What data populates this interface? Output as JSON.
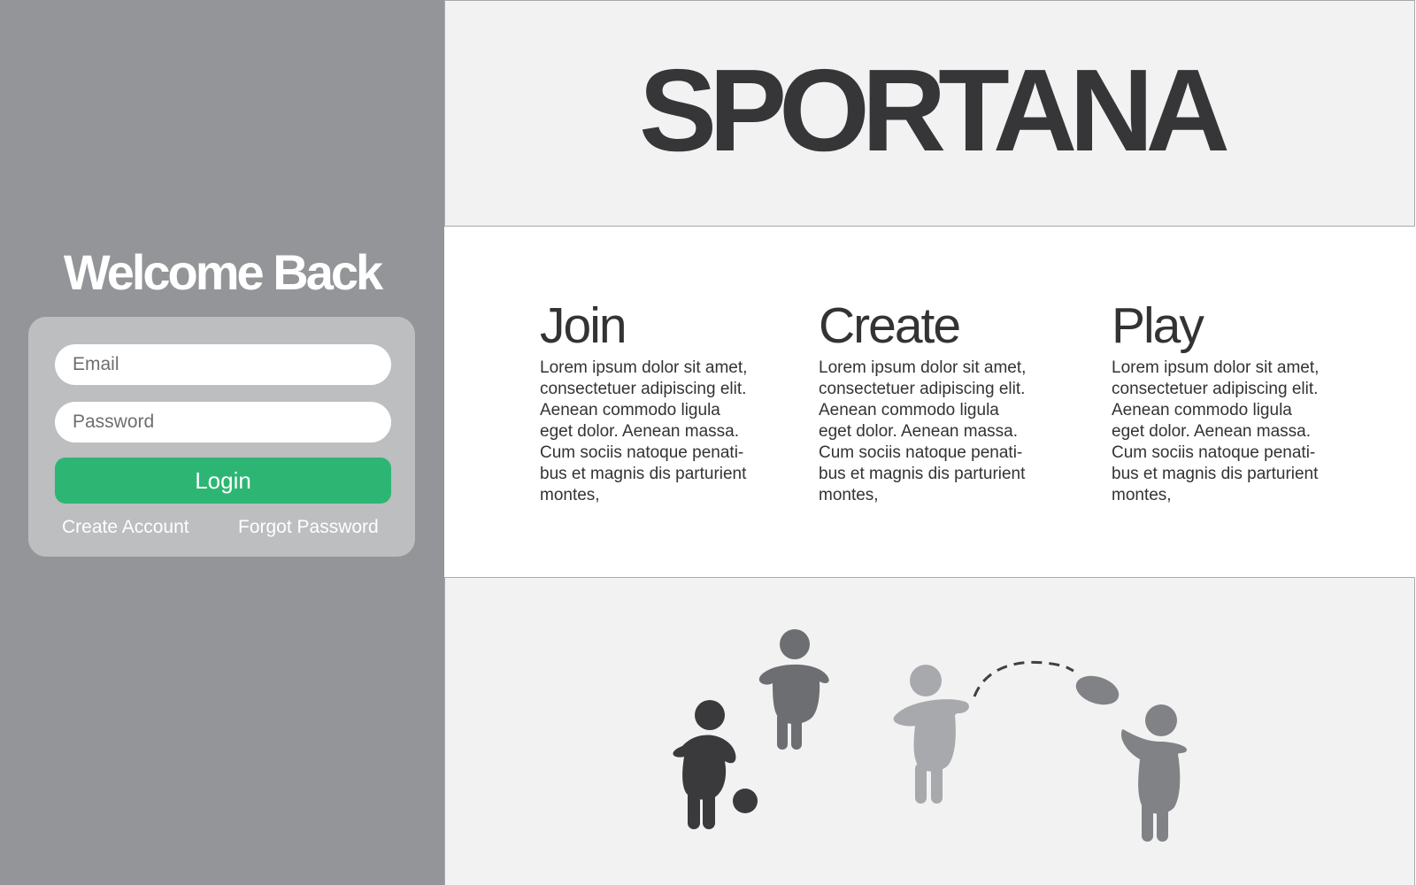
{
  "login": {
    "heading": "Welcome Back",
    "email_placeholder": "Email",
    "password_placeholder": "Password",
    "login_label": "Login",
    "create_account_label": "Create Account",
    "forgot_password_label": "Forgot Password",
    "accent_color": "#2db673"
  },
  "header": {
    "brand": "SPORTANA"
  },
  "features": [
    {
      "title": "Join",
      "body": "Lorem ipsum dolor sit amet,\nconsectetuer adipiscing elit.\nAenean commodo ligula\neget dolor. Aenean massa.\nCum sociis natoque penati-\nbus et magnis dis parturient\nmontes,"
    },
    {
      "title": "Create",
      "body": "Lorem ipsum dolor sit amet,\nconsectetuer adipiscing elit.\nAenean commodo ligula\neget dolor. Aenean massa.\nCum sociis natoque penati-\nbus et magnis dis parturient\nmontes,"
    },
    {
      "title": "Play",
      "body": "Lorem ipsum dolor sit amet,\nconsectetuer adipiscing elit.\nAenean commodo ligula\neget dolor. Aenean massa.\nCum sociis natoque penati-\nbus et magnis dis parturient\nmontes,"
    }
  ],
  "illustration": {
    "icons": [
      "soccer-player-icon",
      "jumping-player-icon",
      "frisbee-thrower-icon",
      "frisbee-catcher-icon",
      "ball-icon",
      "frisbee-icon"
    ]
  }
}
